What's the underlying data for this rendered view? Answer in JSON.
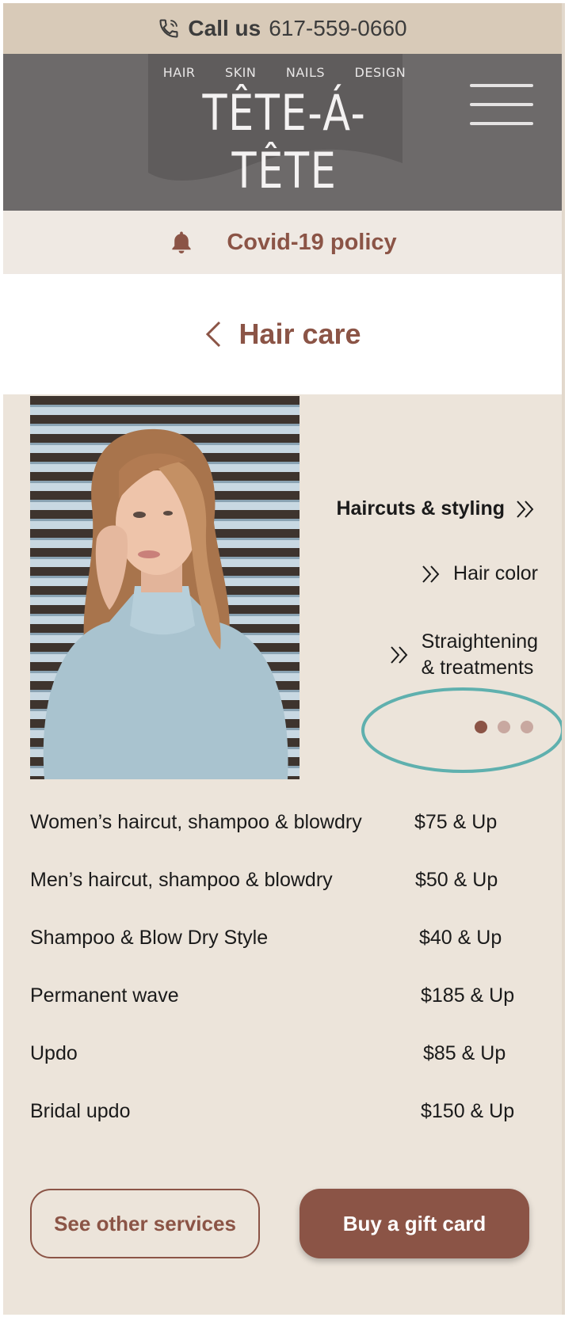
{
  "callbar": {
    "label": "Call us",
    "phone": "617-559-0660",
    "icon": "phone-icon"
  },
  "header": {
    "logo": {
      "tags": [
        "HAIR",
        "SKIN",
        "NAILS",
        "DESIGN"
      ],
      "name": "TÊTE-Á-TÊTE"
    },
    "menu_icon": "hamburger-menu-icon"
  },
  "covid": {
    "label": "Covid-19 policy",
    "icon": "bell-icon"
  },
  "page": {
    "title": "Hair care",
    "back_icon": "chevron-left-icon"
  },
  "categories": [
    {
      "label": "Haircuts & styling",
      "active": true
    },
    {
      "label": "Hair color",
      "active": false
    },
    {
      "label_line1": "Straightening",
      "label_line2": "& treatments",
      "active": false
    }
  ],
  "carousel": {
    "pages": 3,
    "current": 1
  },
  "services": [
    {
      "name": "Women’s haircut, shampoo & blowdry",
      "price": "$75 & Up"
    },
    {
      "name": "Men’s haircut, shampoo & blowdry",
      "price": "$50 & Up"
    },
    {
      "name": "Shampoo & Blow Dry Style",
      "price": "$40 & Up"
    },
    {
      "name": "Permanent wave",
      "price": "$185 & Up"
    },
    {
      "name": "Updo",
      "price": "$85 & Up"
    },
    {
      "name": "Bridal updo",
      "price": "$150 & Up"
    }
  ],
  "buttons": {
    "other_services": "See other services",
    "gift_card": "Buy a gift card"
  },
  "colors": {
    "brand": "#8b5446",
    "header_bg": "#6d6a6a",
    "callbar_bg": "#d8cab8",
    "page_bg": "#ece4da",
    "annotation_ring": "#5fb0ae",
    "dot_active": "#8b5446",
    "dot_inactive": "#c8a8a0"
  }
}
